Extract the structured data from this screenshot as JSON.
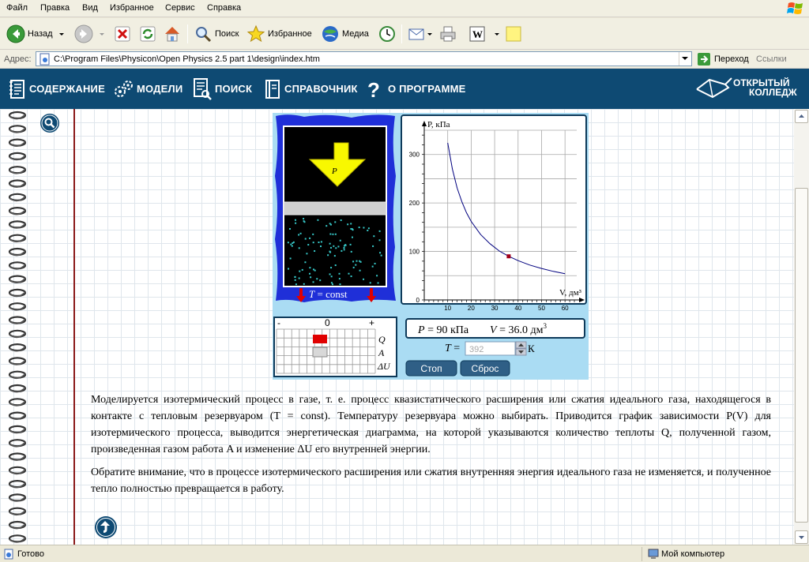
{
  "menu": [
    "Файл",
    "Правка",
    "Вид",
    "Избранное",
    "Сервис",
    "Справка"
  ],
  "toolbar": {
    "back_label": "Назад",
    "search_label": "Поиск",
    "favorites_label": "Избранное",
    "media_label": "Медиа"
  },
  "address": {
    "label": "Адрес:",
    "value": "C:\\Program Files\\Physicon\\Open Physics 2.5 part 1\\design\\index.htm",
    "go_label": "Переход",
    "links_label": "Ссылки"
  },
  "nav": {
    "contents": "СОДЕРЖАНИЕ",
    "models": "МОДЕЛИ",
    "search": "ПОИСК",
    "reference": "СПРАВОЧНИК",
    "about": "О ПРОГРАММЕ",
    "logo_line1": "ОТКРЫТЫЙ",
    "logo_line2": "КОЛЛЕДЖ"
  },
  "sim": {
    "piston_label": "P",
    "temp_label_var": "T",
    "temp_label_rest": " = const",
    "energy_minus": "-",
    "energy_zero": "0",
    "energy_plus": "+",
    "energy_Q": "Q",
    "energy_A": "A",
    "energy_dU": "ΔU",
    "readout_P_var": "P",
    "readout_P_val": " = 90 кПа",
    "readout_V_var": "V",
    "readout_V_val": " = 36.0 дм",
    "readout_V_sup": "3",
    "T_label_var": "T",
    "T_label_rest": " =",
    "T_input_value": "392",
    "T_unit": "К",
    "stop_label": "Стоп",
    "reset_label": "Сброс"
  },
  "chart_data": {
    "type": "line",
    "title": "",
    "xlabel": "V, дм³",
    "ylabel": "P, кПа",
    "xlim": [
      0,
      65
    ],
    "ylim": [
      0,
      350
    ],
    "x_ticks": [
      10,
      20,
      30,
      40,
      50,
      60
    ],
    "y_ticks": [
      0,
      100,
      200,
      300
    ],
    "x_tick_labels": [
      "10",
      "20",
      "30",
      "40",
      "50",
      "60"
    ],
    "y_tick_labels": [
      "0",
      "100",
      "200",
      "300"
    ],
    "grid": true,
    "series": [
      {
        "x": [
          10,
          12,
          14,
          16,
          18,
          20,
          24,
          28,
          32,
          36,
          40,
          45,
          50,
          55,
          60
        ],
        "y": [
          324,
          270,
          231,
          203,
          180,
          162,
          135,
          116,
          101,
          90,
          81,
          72,
          65,
          59,
          54
        ]
      }
    ],
    "marker": {
      "x": 36,
      "y": 90
    },
    "line_color": "#00007f",
    "marker_color": "#a0001a"
  },
  "paragraphs": {
    "p1": "Моделируется изотермический процесс в газе, т. е. процесс квазистатического расширения или сжатия идеального газа, находящегося в контакте с тепловым резервуаром (T = const). Температуру резервуара можно выбирать. Приводится график зависимости P(V) для изотермического процесса, выводится энергетическая диаграмма, на которой указываются количество теплоты Q, полученной газом, произведенная газом работа A и изменение ΔU его внутренней энергии.",
    "p2": "Обратите внимание, что в процессе изотермического расширения или сжатия внутренняя энергия идеального газа не изменяется, и полученное тепло полностью превращается в работу."
  },
  "status": {
    "left": "Готово",
    "zone": "Мой компьютер"
  },
  "colors": {
    "nav_bg": "#0e4a73",
    "sim_bg": "#aadcf3",
    "reservoir": "#1f2fd8",
    "arrow": "#f8f800",
    "heat_arrow": "#e00000",
    "particle": "#37c8c8"
  }
}
